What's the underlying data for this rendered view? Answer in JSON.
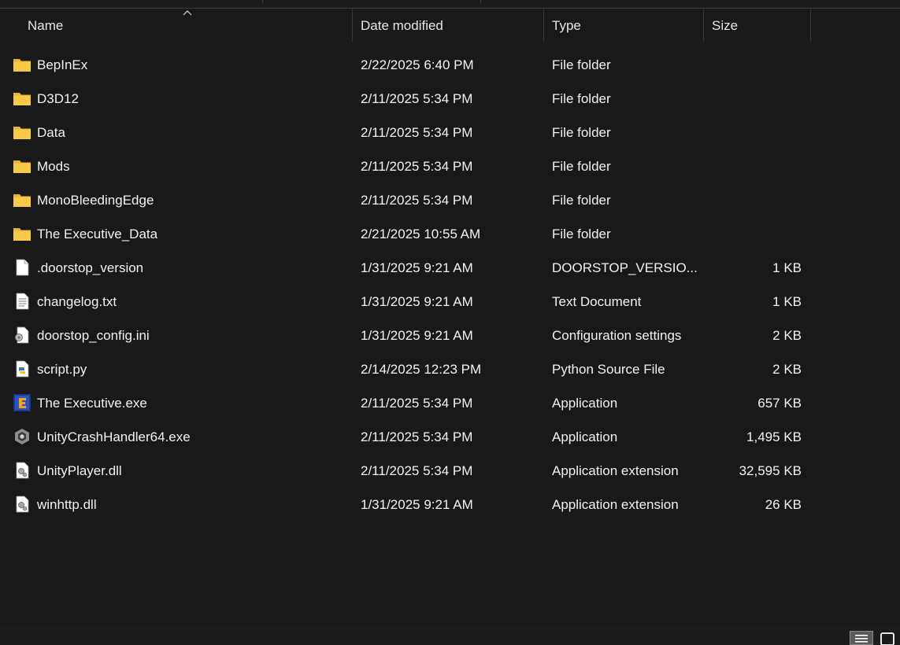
{
  "columns": {
    "name": "Name",
    "date": "Date modified",
    "type": "Type",
    "size": "Size"
  },
  "sort": {
    "column": "name",
    "direction": "ascending"
  },
  "colors": {
    "background": "#191919",
    "folder": "#f7c948",
    "text": "#f2f2f2"
  },
  "files": [
    {
      "name": "BepInEx",
      "date": "2/22/2025 6:40 PM",
      "type": "File folder",
      "size": "",
      "icon": "folder-icon"
    },
    {
      "name": "D3D12",
      "date": "2/11/2025 5:34 PM",
      "type": "File folder",
      "size": "",
      "icon": "folder-icon"
    },
    {
      "name": "Data",
      "date": "2/11/2025 5:34 PM",
      "type": "File folder",
      "size": "",
      "icon": "folder-icon"
    },
    {
      "name": "Mods",
      "date": "2/11/2025 5:34 PM",
      "type": "File folder",
      "size": "",
      "icon": "folder-icon"
    },
    {
      "name": "MonoBleedingEdge",
      "date": "2/11/2025 5:34 PM",
      "type": "File folder",
      "size": "",
      "icon": "folder-icon"
    },
    {
      "name": "The Executive_Data",
      "date": "2/21/2025 10:55 AM",
      "type": "File folder",
      "size": "",
      "icon": "folder-icon"
    },
    {
      "name": ".doorstop_version",
      "date": "1/31/2025 9:21 AM",
      "type": "DOORSTOP_VERSIO...",
      "size": "1 KB",
      "icon": "blank-file-icon"
    },
    {
      "name": "changelog.txt",
      "date": "1/31/2025 9:21 AM",
      "type": "Text Document",
      "size": "1 KB",
      "icon": "text-file-icon"
    },
    {
      "name": "doorstop_config.ini",
      "date": "1/31/2025 9:21 AM",
      "type": "Configuration settings",
      "size": "2 KB",
      "icon": "config-file-icon"
    },
    {
      "name": "script.py",
      "date": "2/14/2025 12:23 PM",
      "type": "Python Source File",
      "size": "2 KB",
      "icon": "python-file-icon"
    },
    {
      "name": "The Executive.exe",
      "date": "2/11/2025 5:34 PM",
      "type": "Application",
      "size": "657 KB",
      "icon": "game-exe-icon"
    },
    {
      "name": "UnityCrashHandler64.exe",
      "date": "2/11/2025 5:34 PM",
      "type": "Application",
      "size": "1,495 KB",
      "icon": "unity-icon"
    },
    {
      "name": "UnityPlayer.dll",
      "date": "2/11/2025 5:34 PM",
      "type": "Application extension",
      "size": "32,595 KB",
      "icon": "dll-file-icon"
    },
    {
      "name": "winhttp.dll",
      "date": "1/31/2025 9:21 AM",
      "type": "Application extension",
      "size": "26 KB",
      "icon": "dll-file-icon"
    }
  ],
  "view_modes": [
    {
      "id": "details",
      "icon": "details-view-icon",
      "active": true
    },
    {
      "id": "tiles",
      "icon": "large-icons-view-icon",
      "active": false
    }
  ]
}
